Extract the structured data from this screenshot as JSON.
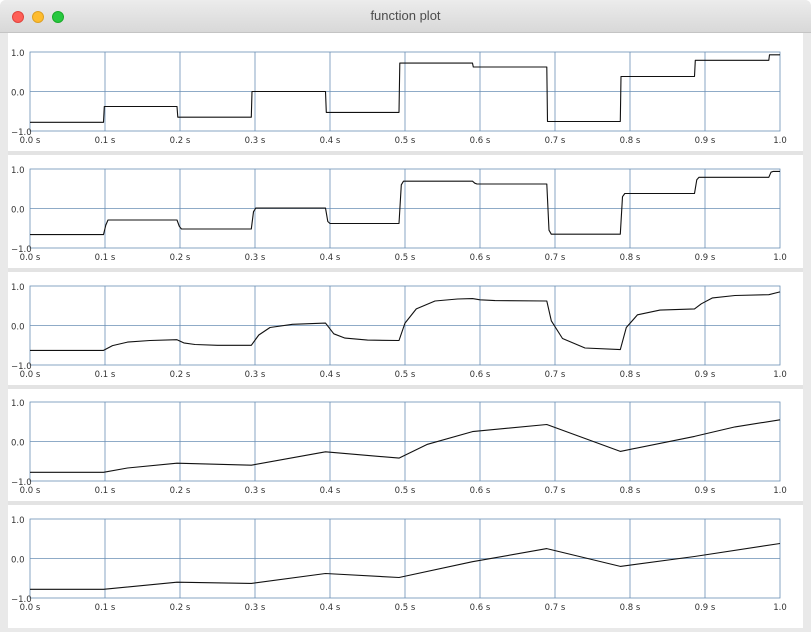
{
  "window": {
    "title": "function plot"
  },
  "colors": {
    "grid": "#6a8fb5",
    "line": "#111111",
    "separator": "#e3e3e3"
  },
  "chart_data": [
    {
      "type": "line",
      "xlim": [
        0,
        1
      ],
      "ylim": [
        -1,
        1
      ],
      "xticks": [
        0,
        0.1,
        0.2,
        0.3,
        0.4,
        0.5,
        0.6,
        0.7,
        0.8,
        0.9,
        1.0
      ],
      "xtick_labels": [
        "0.0 s",
        "0.1 s",
        "0.2 s",
        "0.3 s",
        "0.4 s",
        "0.5 s",
        "0.6 s",
        "0.7 s",
        "0.8 s",
        "0.9 s",
        "1.0"
      ],
      "yticks": [
        -1,
        0,
        1
      ],
      "ytick_labels": [
        "−1.0",
        "0.0",
        "1.0"
      ],
      "grid": true,
      "series": [
        {
          "x": [
            0,
            0.098,
            0.099,
            0.196,
            0.197,
            0.295,
            0.296,
            0.394,
            0.395,
            0.492,
            0.493,
            0.59,
            0.591,
            0.689,
            0.69,
            0.787,
            0.788,
            0.886,
            0.887,
            0.985,
            0.986,
            1.0
          ],
          "y": [
            -0.78,
            -0.78,
            -0.38,
            -0.38,
            -0.65,
            -0.65,
            0.0,
            0.0,
            -0.53,
            -0.53,
            0.72,
            0.72,
            0.62,
            0.62,
            -0.76,
            -0.76,
            0.38,
            0.38,
            0.79,
            0.79,
            0.93,
            0.93
          ]
        }
      ]
    },
    {
      "type": "line",
      "xlim": [
        0,
        1
      ],
      "ylim": [
        -1,
        1
      ],
      "xticks": [
        0,
        0.1,
        0.2,
        0.3,
        0.4,
        0.5,
        0.6,
        0.7,
        0.8,
        0.9,
        1.0
      ],
      "xtick_labels": [
        "0.0 s",
        "0.1 s",
        "0.2 s",
        "0.3 s",
        "0.4 s",
        "0.5 s",
        "0.6 s",
        "0.7 s",
        "0.8 s",
        "0.9 s",
        "1.0"
      ],
      "yticks": [
        -1,
        0,
        1
      ],
      "ytick_labels": [
        "−1.0",
        "0.0",
        "1.0"
      ],
      "grid": true,
      "series": [
        {
          "x": [
            0,
            0.098,
            0.101,
            0.104,
            0.196,
            0.199,
            0.202,
            0.295,
            0.298,
            0.301,
            0.394,
            0.397,
            0.4,
            0.492,
            0.495,
            0.498,
            0.59,
            0.593,
            0.596,
            0.689,
            0.692,
            0.695,
            0.787,
            0.79,
            0.793,
            0.886,
            0.889,
            0.892,
            0.985,
            0.988,
            0.991,
            1.0
          ],
          "y": [
            -0.66,
            -0.66,
            -0.42,
            -0.29,
            -0.29,
            -0.45,
            -0.52,
            -0.52,
            -0.08,
            0.01,
            0.01,
            -0.33,
            -0.38,
            -0.38,
            0.6,
            0.69,
            0.69,
            0.64,
            0.62,
            0.62,
            -0.55,
            -0.65,
            -0.65,
            0.3,
            0.38,
            0.38,
            0.73,
            0.79,
            0.79,
            0.92,
            0.94,
            0.94
          ]
        }
      ]
    },
    {
      "type": "line",
      "xlim": [
        0,
        1
      ],
      "ylim": [
        -1,
        1
      ],
      "xticks": [
        0,
        0.1,
        0.2,
        0.3,
        0.4,
        0.5,
        0.6,
        0.7,
        0.8,
        0.9,
        1.0
      ],
      "xtick_labels": [
        "0.0 s",
        "0.1 s",
        "0.2 s",
        "0.3 s",
        "0.4 s",
        "0.5 s",
        "0.6 s",
        "0.7 s",
        "0.8 s",
        "0.9 s",
        "1.0"
      ],
      "yticks": [
        -1,
        0,
        1
      ],
      "ytick_labels": [
        "−1.0",
        "0.0",
        "1.0"
      ],
      "grid": true,
      "series": [
        {
          "x": [
            0,
            0.098,
            0.11,
            0.13,
            0.16,
            0.196,
            0.205,
            0.22,
            0.25,
            0.295,
            0.305,
            0.32,
            0.35,
            0.394,
            0.405,
            0.42,
            0.45,
            0.492,
            0.5,
            0.515,
            0.54,
            0.57,
            0.59,
            0.6,
            0.62,
            0.689,
            0.695,
            0.71,
            0.74,
            0.787,
            0.795,
            0.81,
            0.84,
            0.886,
            0.895,
            0.91,
            0.94,
            0.985,
            1.0
          ],
          "y": [
            -0.63,
            -0.63,
            -0.51,
            -0.42,
            -0.38,
            -0.36,
            -0.44,
            -0.48,
            -0.5,
            -0.5,
            -0.24,
            -0.05,
            0.03,
            0.06,
            -0.21,
            -0.32,
            -0.37,
            -0.38,
            0.06,
            0.42,
            0.62,
            0.67,
            0.68,
            0.65,
            0.63,
            0.62,
            0.12,
            -0.33,
            -0.57,
            -0.61,
            -0.05,
            0.27,
            0.39,
            0.42,
            0.55,
            0.7,
            0.76,
            0.78,
            0.85
          ]
        }
      ]
    },
    {
      "type": "line",
      "xlim": [
        0,
        1
      ],
      "ylim": [
        -1,
        1
      ],
      "xticks": [
        0,
        0.1,
        0.2,
        0.3,
        0.4,
        0.5,
        0.6,
        0.7,
        0.8,
        0.9,
        1.0
      ],
      "xtick_labels": [
        "0.0 s",
        "0.1 s",
        "0.2 s",
        "0.3 s",
        "0.4 s",
        "0.5 s",
        "0.6 s",
        "0.7 s",
        "0.8 s",
        "0.9 s",
        "1.0"
      ],
      "yticks": [
        -1,
        0,
        1
      ],
      "ytick_labels": [
        "−1.0",
        "0.0",
        "1.0"
      ],
      "grid": true,
      "series": [
        {
          "x": [
            0,
            0.098,
            0.13,
            0.196,
            0.295,
            0.394,
            0.492,
            0.53,
            0.59,
            0.689,
            0.787,
            0.886,
            0.94,
            1.0
          ],
          "y": [
            -0.78,
            -0.78,
            -0.67,
            -0.55,
            -0.6,
            -0.26,
            -0.42,
            -0.07,
            0.25,
            0.43,
            -0.25,
            0.13,
            0.37,
            0.55
          ]
        }
      ]
    },
    {
      "type": "line",
      "xlim": [
        0,
        1
      ],
      "ylim": [
        -1,
        1
      ],
      "xticks": [
        0,
        0.1,
        0.2,
        0.3,
        0.4,
        0.5,
        0.6,
        0.7,
        0.8,
        0.9,
        1.0
      ],
      "xtick_labels": [
        "0.0 s",
        "0.1 s",
        "0.2 s",
        "0.3 s",
        "0.4 s",
        "0.5 s",
        "0.6 s",
        "0.7 s",
        "0.8 s",
        "0.9 s",
        "1.0"
      ],
      "yticks": [
        -1,
        0,
        1
      ],
      "ytick_labels": [
        "−1.0",
        "0.0",
        "1.0"
      ],
      "grid": true,
      "series": [
        {
          "x": [
            0,
            0.098,
            0.196,
            0.295,
            0.394,
            0.492,
            0.59,
            0.689,
            0.787,
            0.886,
            1.0
          ],
          "y": [
            -0.78,
            -0.78,
            -0.6,
            -0.63,
            -0.38,
            -0.48,
            -0.08,
            0.25,
            -0.2,
            0.05,
            0.38
          ]
        }
      ]
    }
  ]
}
